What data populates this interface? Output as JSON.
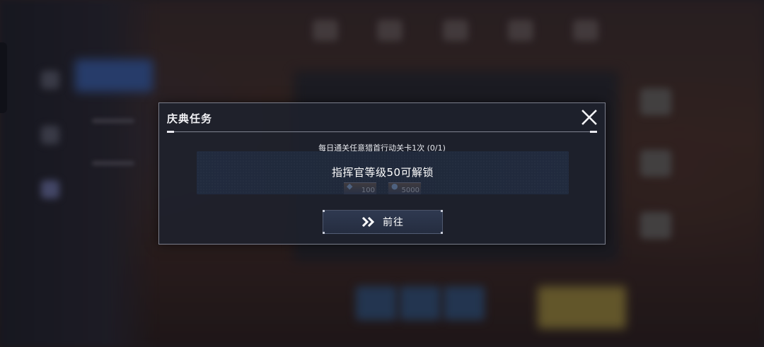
{
  "dialog": {
    "title": "庆典任务",
    "close_icon": "close-icon"
  },
  "task": {
    "description": "每日通关任意猎首行动关卡1次 (0/1)",
    "progress_current": 0,
    "progress_total": 1,
    "lock_text": "指挥官等级50可解锁",
    "rewards": [
      {
        "icon": "crystal-icon",
        "count": "100"
      },
      {
        "icon": "coin-icon",
        "count": "5000"
      }
    ]
  },
  "go_button": {
    "label": "前往",
    "icon": "double-chevron-right-icon"
  }
}
